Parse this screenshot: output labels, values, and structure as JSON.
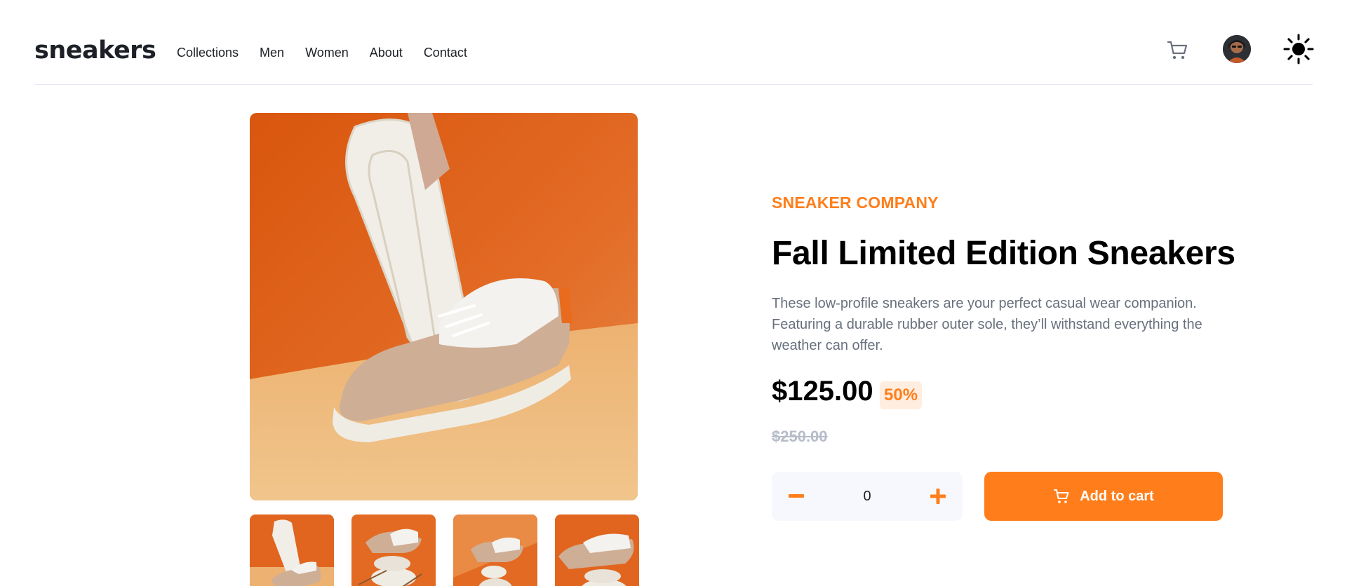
{
  "header": {
    "logo": "sneakers",
    "nav": [
      "Collections",
      "Men",
      "Women",
      "About",
      "Contact"
    ]
  },
  "product": {
    "company": "SNEAKER COMPANY",
    "title": "Fall Limited Edition Sneakers",
    "description": "These low-profile sneakers are your perfect casual wear companion. Featuring a durable rubber outer sole, they’ll withstand everything the weather can offer.",
    "price": "$125.00",
    "discount": "50%",
    "old_price": "$250.00",
    "quantity": "0",
    "add_to_cart_label": "Add to cart"
  },
  "icons": {
    "cart": "cart-icon",
    "avatar": "avatar",
    "theme": "sun-icon",
    "minus": "minus-icon",
    "plus": "plus-icon"
  },
  "colors": {
    "accent": "#ff7e1b",
    "accent_light": "#ffede0",
    "text_dark": "#1d2026",
    "text_muted": "#68707d",
    "text_strike": "#b6bcc8",
    "qty_bg": "#f6f8fd"
  }
}
